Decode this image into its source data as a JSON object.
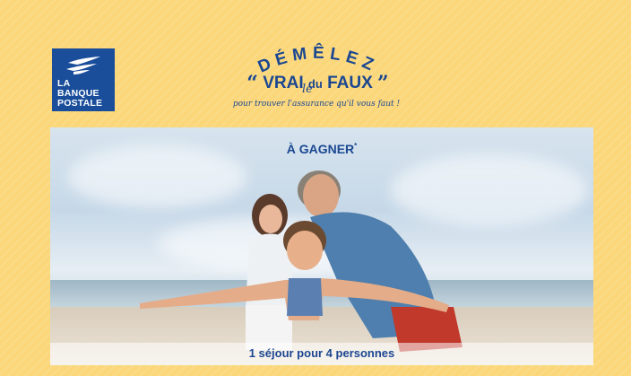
{
  "logo": {
    "line1": "LA",
    "line2": "BANQUE",
    "line3": "POSTALE"
  },
  "headline": {
    "arc_text": "DÉMÊLEZ",
    "le": "le",
    "open_quote": "“",
    "vrai": "VRAI",
    "du": "du",
    "faux": "FAUX",
    "close_quote": "”",
    "tagline": "pour trouver l'assurance qu'il vous faut !"
  },
  "prize": {
    "title": "À GAGNER",
    "asterisk": "*",
    "caption": "1 séjour pour 4 personnes"
  },
  "colors": {
    "background": "#fbd77a",
    "brand_blue": "#1b4791",
    "logo_blue": "#1a4e9b"
  }
}
